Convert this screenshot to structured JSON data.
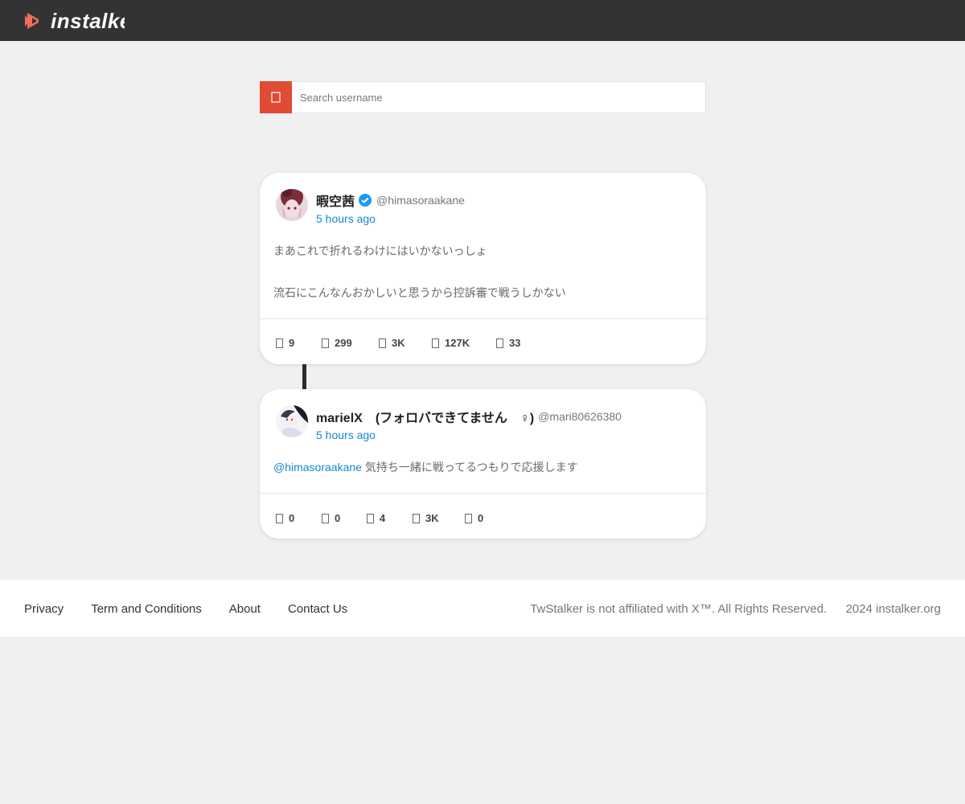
{
  "brand": {
    "name": "instalker",
    "accent": "#df4b33",
    "logo_color": "#ef6f5c"
  },
  "search": {
    "placeholder": "Search username",
    "icon": "search-icon"
  },
  "tweets": [
    {
      "display_name": "暇空茜",
      "verified": true,
      "handle": "@himasoraakane",
      "time": "5 hours ago",
      "paragraphs": [
        "まあこれで折れるわけにはいかないっしょ",
        "流石にこんなんおかしいと思うから控訴審で戦うしかない"
      ],
      "stats": [
        {
          "icon": "reply-icon",
          "value": "9"
        },
        {
          "icon": "retweet-icon",
          "value": "299"
        },
        {
          "icon": "like-icon",
          "value": "3K"
        },
        {
          "icon": "views-icon",
          "value": "127K"
        },
        {
          "icon": "bookmark-icon",
          "value": "33"
        }
      ]
    },
    {
      "display_name": "marielX (フォロバできてません ♀)",
      "verified": false,
      "handle": "@mari80626380",
      "time": "5 hours ago",
      "mention": "@himasoraakane",
      "text": " 気持ち一緒に戦ってるつもりで応援します",
      "stats": [
        {
          "icon": "reply-icon",
          "value": "0"
        },
        {
          "icon": "retweet-icon",
          "value": "0"
        },
        {
          "icon": "like-icon",
          "value": "4"
        },
        {
          "icon": "views-icon",
          "value": "3K"
        },
        {
          "icon": "bookmark-icon",
          "value": "0"
        }
      ]
    }
  ],
  "footer": {
    "links": [
      "Privacy",
      "Term and Conditions",
      "About",
      "Contact Us"
    ],
    "copyright": "TwStalker is not affiliated with X™. All Rights Reserved.   2024 instalker.org"
  }
}
